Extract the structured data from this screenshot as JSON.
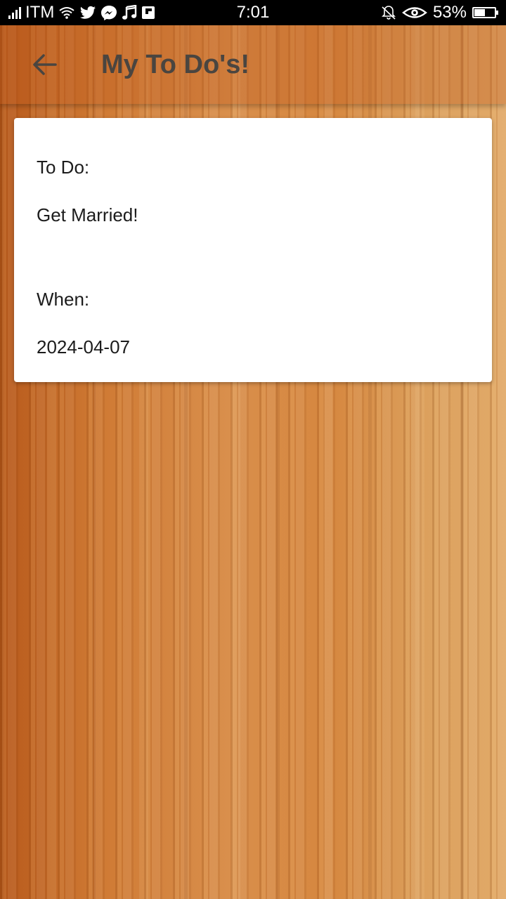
{
  "status_bar": {
    "carrier": "ITM",
    "time": "7:01",
    "battery_percent": "53%",
    "battery_level": 0.53,
    "icons": [
      "signal-icon",
      "wifi-icon",
      "twitter-icon",
      "messenger-icon",
      "music-icon",
      "flipboard-icon",
      "bell-off-icon",
      "eye-icon",
      "battery-icon"
    ]
  },
  "app_bar": {
    "title": "My To Do's!",
    "back_icon": "arrow-left-icon"
  },
  "card": {
    "todo_label": "To Do:",
    "todo_value": "Get Married!",
    "when_label": "When:",
    "when_value": "2024-04-07"
  },
  "colors": {
    "status_bar_bg": "#000000",
    "title_text": "#4a4540",
    "card_bg": "#ffffff",
    "wood_light": "#e2aa69",
    "wood_dark": "#b85a1c"
  }
}
